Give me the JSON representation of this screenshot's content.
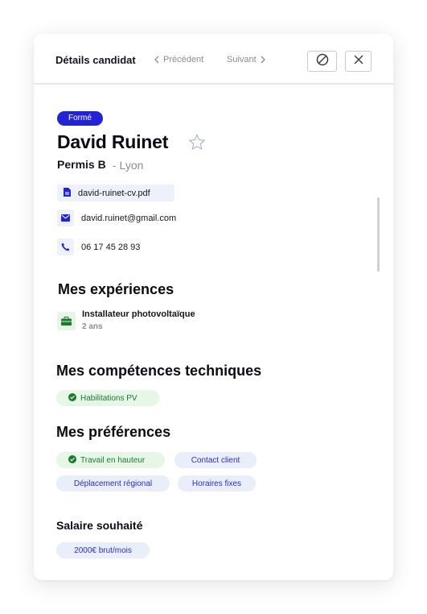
{
  "header": {
    "title": "Détails candidat",
    "prev_label": "Précédent",
    "next_label": "Suivant",
    "icons": {
      "prev": "chevron-left-icon",
      "next": "chevron-right-icon",
      "block": "block-icon",
      "close": "close-icon"
    }
  },
  "candidate": {
    "status_badge": "Formé",
    "name": "David Ruinet",
    "license": "Permis B",
    "city": "- Lyon",
    "cv_file": "david-ruinet-cv.pdf",
    "email": "david.ruinet@gmail.com",
    "phone": "06 17 45 28 93"
  },
  "experiences": {
    "title": "Mes expériences",
    "items": [
      {
        "job": "Installateur photovoltaïque",
        "duration": "2 ans"
      }
    ]
  },
  "skills": {
    "title": "Mes compétences techniques",
    "items": [
      {
        "label": "Habilitations PV",
        "verified": true
      }
    ]
  },
  "preferences": {
    "title": "Mes préférences",
    "items": [
      {
        "label": "Travail en hauteur",
        "verified": true
      },
      {
        "label": "Contact client",
        "verified": false
      },
      {
        "label": "Déplacement régional",
        "verified": false
      },
      {
        "label": "Horaires fixes",
        "verified": false
      }
    ]
  },
  "salary": {
    "title": "Salaire souhaité",
    "value": "2000€ brut/mois"
  },
  "colors": {
    "accent": "#2323d6",
    "tag_blue_bg": "#eaedfa",
    "tag_green_bg": "#e6f7e8",
    "verified_green": "#1b7a2b"
  }
}
